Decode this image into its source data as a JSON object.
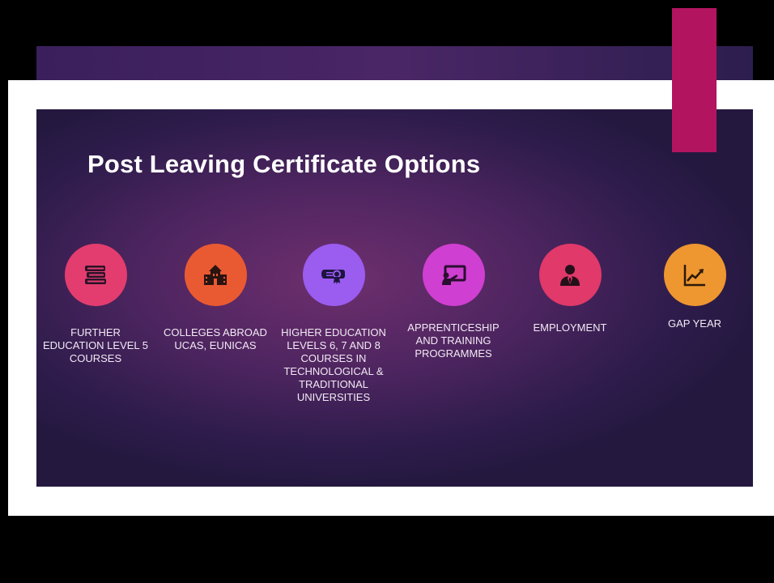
{
  "slide": {
    "title": "Post Leaving Certificate Options",
    "accent_color": "#b3145f",
    "options": [
      {
        "label": "FURTHER EDUCATION LEVEL 5 COURSES",
        "icon": "books-icon",
        "color": "#e23d6e"
      },
      {
        "label": "COLLEGES ABROAD UCAS, EUNICAS",
        "icon": "school-building-icon",
        "color": "#ea5a32"
      },
      {
        "label": "HIGHER EDUCATION LEVELS 6, 7 AND 8 COURSES IN TECHNOLOGICAL & TRADITIONAL UNIVERSITIES",
        "icon": "diploma-icon",
        "color": "#9b5cf0"
      },
      {
        "label": "APPRENTICESHIP AND TRAINING PROGRAMMES",
        "icon": "presentation-icon",
        "color": "#cf3fd1"
      },
      {
        "label": "EMPLOYMENT",
        "icon": "businessman-icon",
        "color": "#e0396a"
      },
      {
        "label": "GAP YEAR",
        "icon": "chart-trend-icon",
        "color": "#ee9630"
      }
    ]
  }
}
